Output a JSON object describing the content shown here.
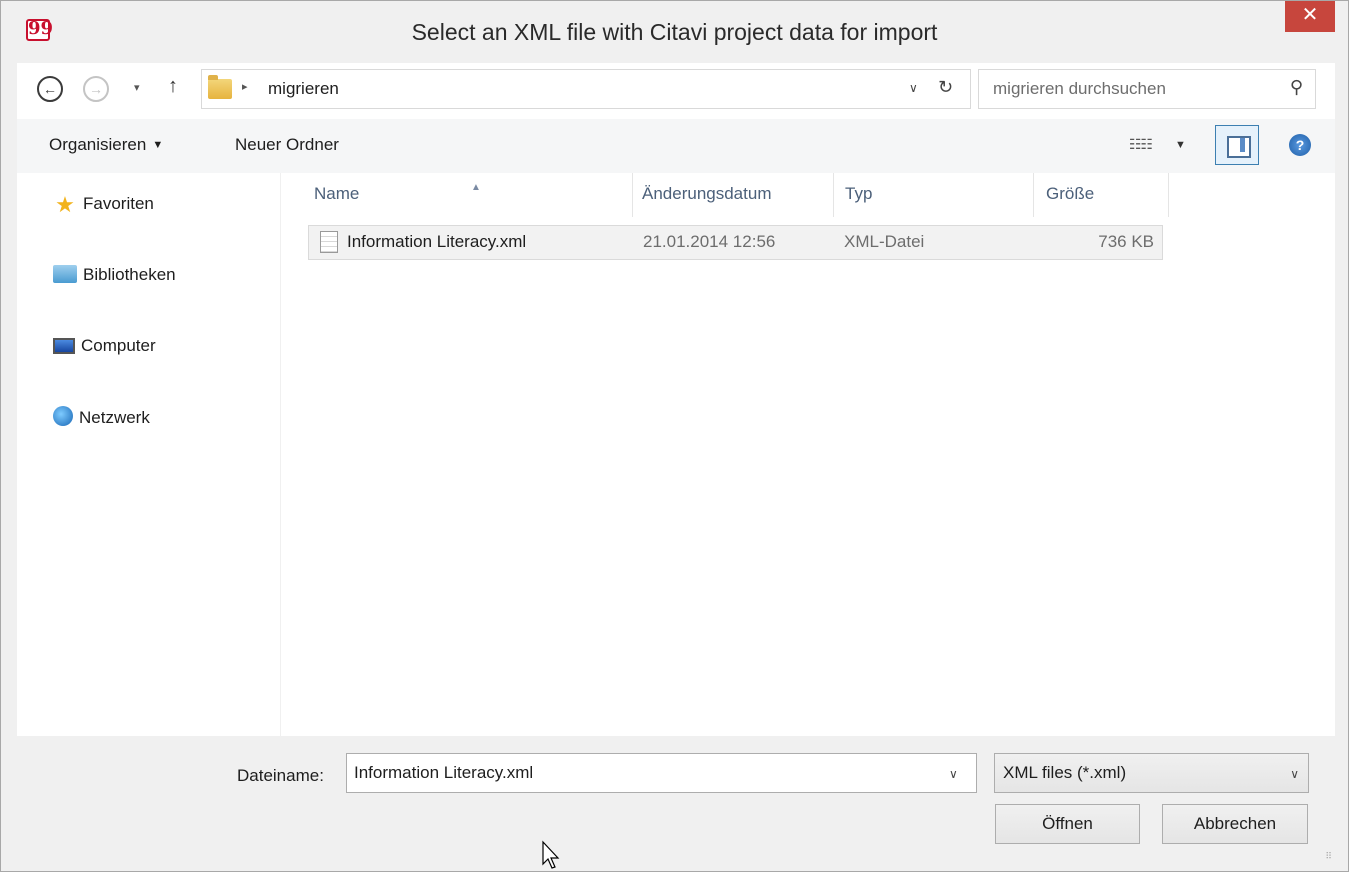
{
  "window": {
    "title": "Select an XML file with Citavi project data for import",
    "app_icon_glyph": "99",
    "close_glyph": "✕",
    "accent_close": "#c7463d"
  },
  "nav": {
    "back_glyph": "←",
    "forward_glyph": "→",
    "recent_glyph": "▾",
    "up_glyph": "↑",
    "breadcrumb_sep": "▸",
    "breadcrumb": "migrieren",
    "address_dropdown_glyph": "∨",
    "refresh_glyph": "↻",
    "search_placeholder": "migrieren durchsuchen",
    "search_glyph": "⚲"
  },
  "commands": {
    "organize": "Organisieren",
    "organize_caret": "▼",
    "new_folder": "Neuer Ordner",
    "view_glyph": "☷☷",
    "view_caret": "▼",
    "help_glyph": "?"
  },
  "sidebar": {
    "items": [
      {
        "label": "Favoriten",
        "icon": "star-icon"
      },
      {
        "label": "Bibliotheken",
        "icon": "library-icon"
      },
      {
        "label": "Computer",
        "icon": "computer-icon"
      },
      {
        "label": "Netzwerk",
        "icon": "network-icon"
      }
    ],
    "star_glyph": "★"
  },
  "filelist": {
    "columns": [
      "Name",
      "Änderungsdatum",
      "Typ",
      "Größe"
    ],
    "sort_glyph": "▲",
    "rows": [
      {
        "name": "Information Literacy.xml",
        "date": "21.01.2014 12:56",
        "type": "XML-Datei",
        "size": "736 KB"
      }
    ]
  },
  "footer": {
    "filename_label": "Dateiname:",
    "filename_value": "Information Literacy.xml",
    "filename_dropdown_glyph": "∨",
    "filter_value": "XML files (*.xml)",
    "filter_dropdown_glyph": "∨",
    "open_label": "Öffnen",
    "cancel_label": "Abbrechen",
    "grip_glyph": "⠿"
  }
}
